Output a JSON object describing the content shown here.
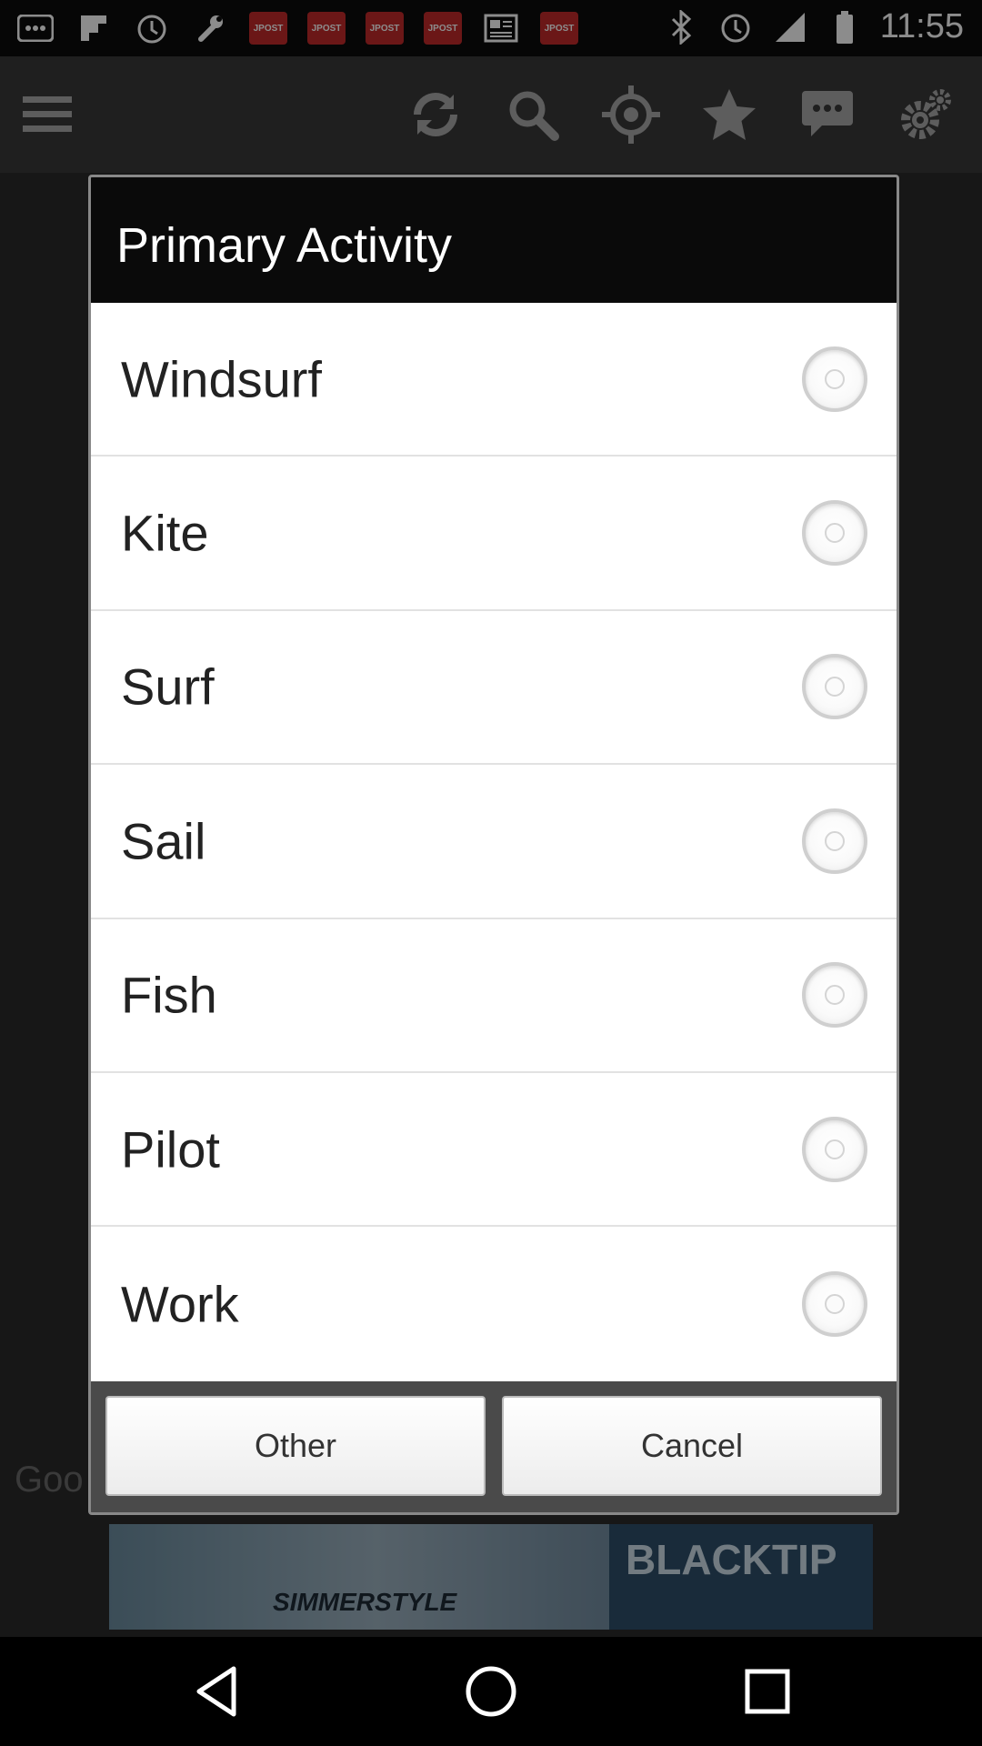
{
  "status_bar": {
    "notification_icons": [
      "menu-icon",
      "flipboard-icon",
      "alarm-icon",
      "wrench-icon",
      "jpost-icon",
      "jpost-icon",
      "jpost-icon",
      "jpost-icon",
      "news-icon",
      "jpost-icon"
    ],
    "jpost_label": "JPOST",
    "right_icons": [
      "bluetooth-icon",
      "alarm-icon",
      "signal-icon",
      "battery-icon"
    ],
    "time": "11:55"
  },
  "toolbar": {
    "icons": [
      "menu-icon",
      "refresh-icon",
      "search-icon",
      "location-icon",
      "star-icon",
      "chat-icon",
      "settings-icon"
    ]
  },
  "background": {
    "partial_text": "Goo",
    "ad": {
      "brand": "SIMMERSTYLE",
      "title": "BLACKTIP"
    }
  },
  "dialog": {
    "title": "Primary Activity",
    "options": [
      {
        "label": "Windsurf",
        "selected": false
      },
      {
        "label": "Kite",
        "selected": false
      },
      {
        "label": "Surf",
        "selected": false
      },
      {
        "label": "Sail",
        "selected": false
      },
      {
        "label": "Fish",
        "selected": false
      },
      {
        "label": "Pilot",
        "selected": false
      },
      {
        "label": "Work",
        "selected": false
      }
    ],
    "buttons": {
      "other": "Other",
      "cancel": "Cancel"
    }
  },
  "nav_bar": {
    "icons": [
      "back-icon",
      "home-icon",
      "recents-icon"
    ]
  }
}
